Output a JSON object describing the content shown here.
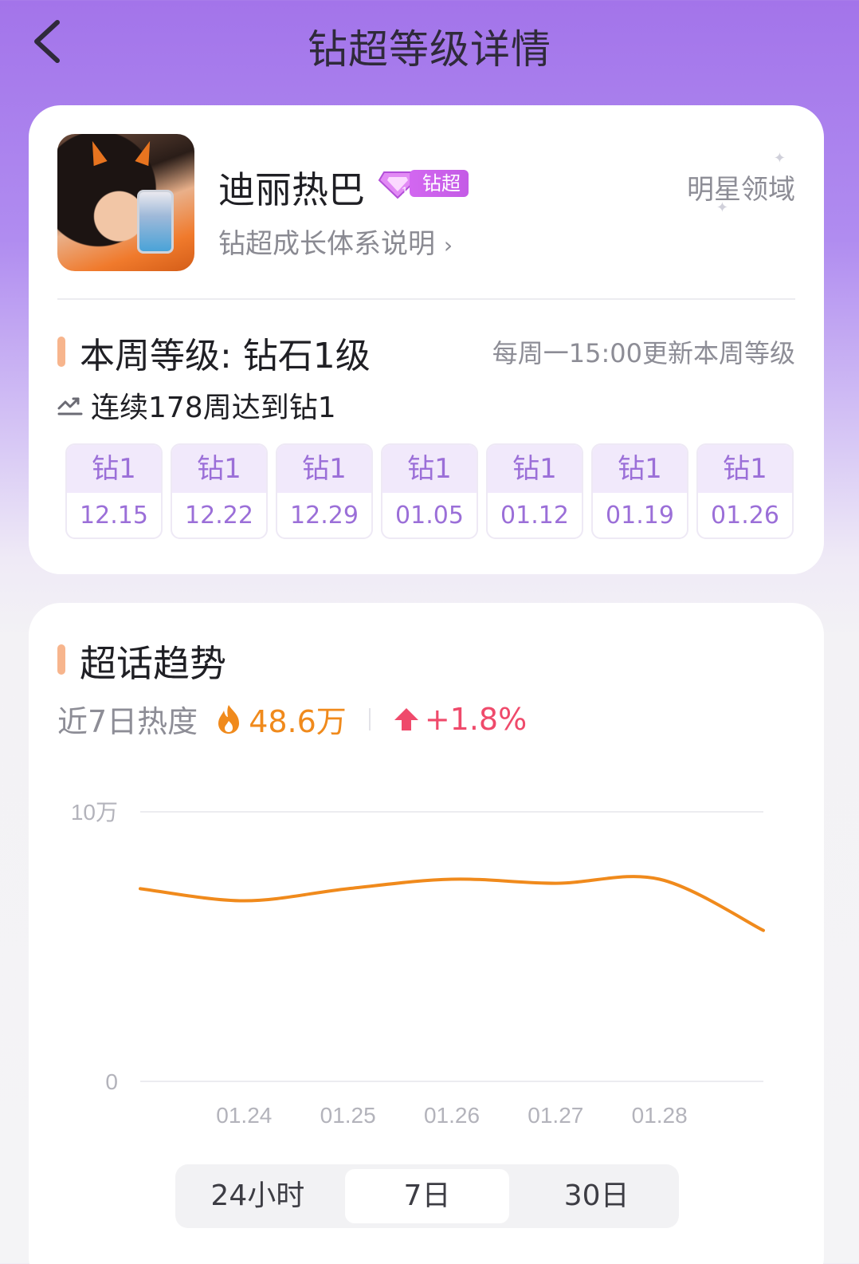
{
  "header": {
    "title": "钻超等级详情"
  },
  "profile": {
    "name": "迪丽热巴",
    "badge_label": "钻超",
    "growth_link": "钻超成长体系说明",
    "domain_tag": "明星领域"
  },
  "level": {
    "title": "本周等级: 钻石1级",
    "update_note": "每周一15:00更新本周等级",
    "streak": "连续178周达到钻1",
    "weeks": [
      {
        "level": "钻1",
        "date": "12.15"
      },
      {
        "level": "钻1",
        "date": "12.22"
      },
      {
        "level": "钻1",
        "date": "12.29"
      },
      {
        "level": "钻1",
        "date": "01.05"
      },
      {
        "level": "钻1",
        "date": "01.12"
      },
      {
        "level": "钻1",
        "date": "01.19"
      },
      {
        "level": "钻1",
        "date": "01.26"
      }
    ]
  },
  "trend": {
    "title": "超话趋势",
    "heat_label": "近7日热度",
    "heat_value": "48.6万",
    "heat_change": "+1.8%",
    "ranges": [
      "24小时",
      "7日",
      "30日"
    ],
    "active_range": "7日"
  },
  "colors": {
    "accent": "#f7b58d",
    "line": "#f08a1c",
    "badge": "#c45be6",
    "up": "#ef4a6b"
  },
  "chart_data": {
    "type": "line",
    "title": "",
    "xlabel": "",
    "ylabel": "",
    "y_ticks": [
      "0",
      "10万"
    ],
    "ylim": [
      0,
      100000
    ],
    "x_ticks": [
      "01.24",
      "01.25",
      "01.26",
      "01.27",
      "01.28"
    ],
    "x": [
      "01.23",
      "01.24",
      "01.25",
      "01.26",
      "01.27",
      "01.28",
      "01.29"
    ],
    "series": [
      {
        "values": [
          71500,
          67000,
          71500,
          75000,
          73500,
          75000,
          56000
        ]
      }
    ],
    "grid": true
  }
}
